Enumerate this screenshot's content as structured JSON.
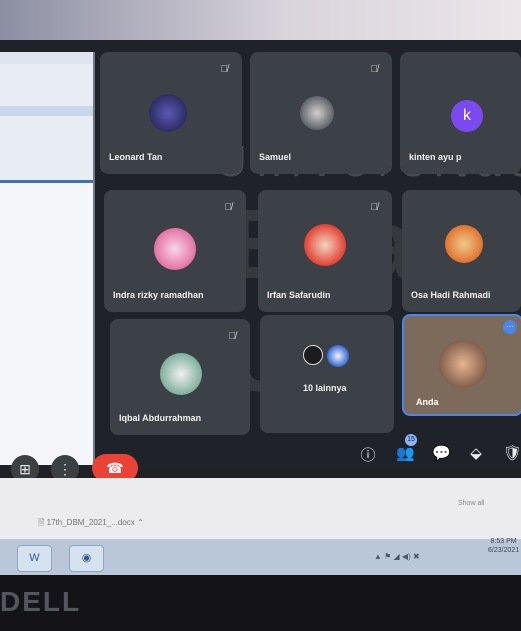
{
  "watermark": {
    "top": "Universitas",
    "bottom": "Esa U"
  },
  "meeting": {
    "participants": [
      {
        "name": "Leonard Tan",
        "muted": true,
        "avatar": "photo"
      },
      {
        "name": "Samuel",
        "muted": true,
        "avatar": "photo"
      },
      {
        "name": "kinten ayu p",
        "muted": false,
        "avatar": "letter",
        "initial": "k",
        "avatar_color": "#7a4af0"
      },
      {
        "name": "Indra rizky ramadhan",
        "muted": true,
        "avatar": "photo"
      },
      {
        "name": "Irfan Safarudin",
        "muted": true,
        "avatar": "photo"
      },
      {
        "name": "Osa Hadi Rahmadi",
        "muted": false,
        "avatar": "photo"
      },
      {
        "name": "Iqbal Abdurrahman",
        "muted": true,
        "avatar": "photo"
      }
    ],
    "others_label": "10 lainnya",
    "self_label": "Anda",
    "people_count": "15",
    "end_call_color": "#ea4335"
  },
  "controls": {
    "present_icon": "present-screen-icon",
    "more_icon": "more-options-icon",
    "end_call_icon": "end-call-icon",
    "info_icon": "info-icon",
    "people_icon": "people-icon",
    "chat_icon": "chat-icon",
    "activities_icon": "activities-icon",
    "security_icon": "security-icon"
  },
  "download_bar": {
    "file": "17th_DBM_2021_...docx",
    "show_all": "Show all"
  },
  "taskbar": {
    "tray": "▲  ⚑  ◢  ◀)  ✖",
    "time": "8:53 PM",
    "date": "6/23/2021"
  },
  "bezel": {
    "brand": "DELL"
  }
}
